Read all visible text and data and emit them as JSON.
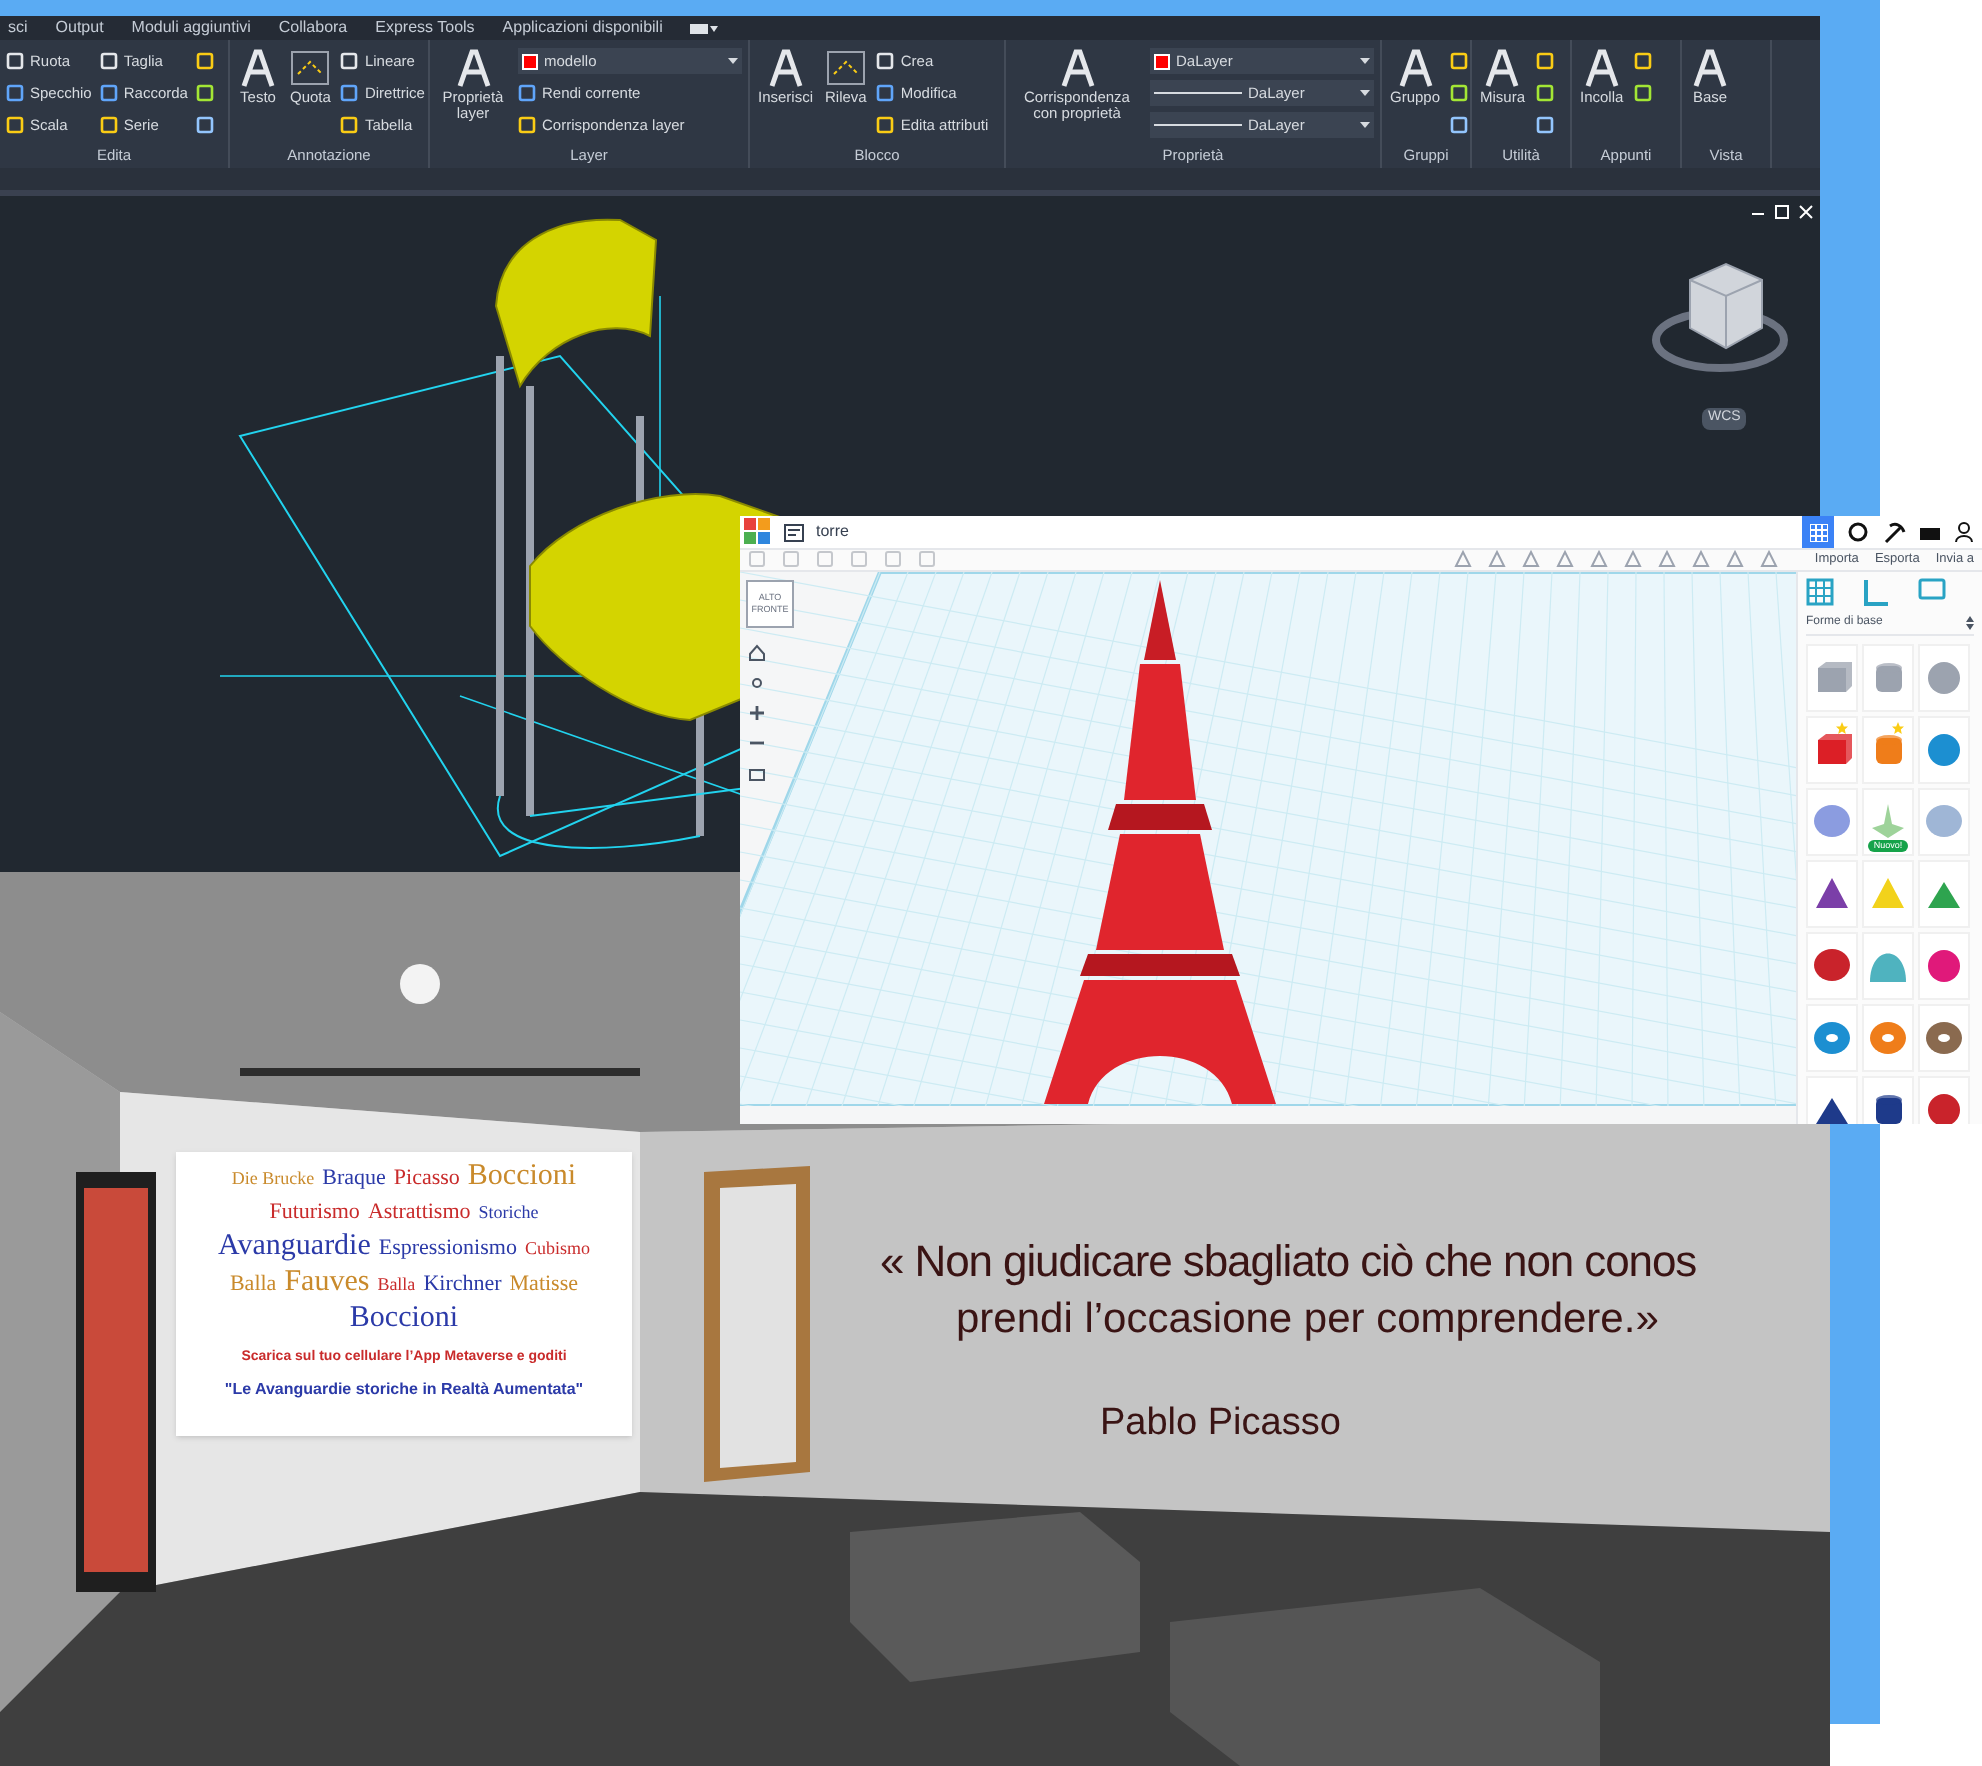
{
  "autocad": {
    "tabs": [
      "sci",
      "Output",
      "Moduli aggiuntivi",
      "Collabora",
      "Express Tools",
      "Applicazioni disponibili"
    ],
    "panels": [
      {
        "title": "Edita",
        "items": [
          {
            "kind": "small",
            "label": "Ruota"
          },
          {
            "kind": "small",
            "label": "Specchio"
          },
          {
            "kind": "small",
            "label": "Scala"
          },
          {
            "kind": "small",
            "label": "Taglia"
          },
          {
            "kind": "small",
            "label": "Raccorda"
          },
          {
            "kind": "small",
            "label": "Serie"
          },
          {
            "kind": "icon"
          },
          {
            "kind": "icon"
          },
          {
            "kind": "icon"
          }
        ]
      },
      {
        "title": "Annotazione",
        "items": [
          {
            "kind": "large",
            "label": "Testo"
          },
          {
            "kind": "large",
            "label": "Quota"
          },
          {
            "kind": "small",
            "label": "Lineare"
          },
          {
            "kind": "small",
            "label": "Direttrice"
          },
          {
            "kind": "small",
            "label": "Tabella"
          }
        ]
      },
      {
        "title": "Layer",
        "items": [
          {
            "kind": "large",
            "label": "Proprietà layer"
          },
          {
            "kind": "dropdown",
            "label": "modello",
            "color": "#ff0000"
          },
          {
            "kind": "small",
            "label": "Rendi corrente"
          },
          {
            "kind": "small",
            "label": "Corrispondenza layer"
          }
        ]
      },
      {
        "title": "Blocco",
        "items": [
          {
            "kind": "large",
            "label": "Inserisci"
          },
          {
            "kind": "large",
            "label": "Rileva"
          },
          {
            "kind": "small",
            "label": "Crea"
          },
          {
            "kind": "small",
            "label": "Modifica"
          },
          {
            "kind": "small",
            "label": "Edita attributi"
          }
        ]
      },
      {
        "title": "Proprietà",
        "items": [
          {
            "kind": "large",
            "label": "Corrispondenza con proprietà"
          },
          {
            "kind": "dropdown",
            "label": "DaLayer",
            "color": "#ff0000"
          },
          {
            "kind": "linetype",
            "label": "DaLayer"
          },
          {
            "kind": "linetype",
            "label": "DaLayer"
          }
        ]
      },
      {
        "title": "Gruppi",
        "items": [
          {
            "kind": "large",
            "label": "Gruppo"
          },
          {
            "kind": "icon"
          },
          {
            "kind": "icon"
          },
          {
            "kind": "icon"
          }
        ]
      },
      {
        "title": "Utilità",
        "items": [
          {
            "kind": "large",
            "label": "Misura"
          },
          {
            "kind": "icon"
          },
          {
            "kind": "icon"
          },
          {
            "kind": "icon"
          }
        ]
      },
      {
        "title": "Appunti",
        "items": [
          {
            "kind": "large",
            "label": "Incolla"
          },
          {
            "kind": "icon"
          },
          {
            "kind": "icon"
          }
        ]
      },
      {
        "title": "Vista",
        "items": [
          {
            "kind": "large",
            "label": "Base"
          }
        ]
      }
    ],
    "viewport": {
      "coordinate_label": "WCS"
    }
  },
  "tinkercad": {
    "title": "torre",
    "panel_tabs": [
      "Importa",
      "Esporta",
      "Invia a"
    ],
    "shape_category": "Forme di base",
    "shapes": [
      {
        "kind": "box",
        "color": "#9ca3af",
        "starred": false
      },
      {
        "kind": "cylinder",
        "color": "#9ca3af",
        "starred": false
      },
      {
        "kind": "sphere",
        "color": "#9ca3af",
        "starred": false
      },
      {
        "kind": "box",
        "color": "#dc1f26",
        "starred": true
      },
      {
        "kind": "cylinder",
        "color": "#ef7d1a",
        "starred": true
      },
      {
        "kind": "sphere",
        "color": "#1c8fd1",
        "starred": false
      },
      {
        "kind": "blob",
        "color": "#8b9ce0",
        "starred": false
      },
      {
        "kind": "spinner",
        "color": "#9ed39a",
        "starred": false,
        "badge": "Nuovo!"
      },
      {
        "kind": "blob",
        "color": "#9fb6d6",
        "starred": false
      },
      {
        "kind": "cone",
        "color": "#7b3fa8",
        "starred": false
      },
      {
        "kind": "cone",
        "color": "#f2d21b",
        "starred": false
      },
      {
        "kind": "wedge",
        "color": "#2ea44f",
        "starred": false
      },
      {
        "kind": "blob",
        "color": "#c9232b",
        "starred": false
      },
      {
        "kind": "halfcylinder",
        "color": "#4fb3bf",
        "starred": false
      },
      {
        "kind": "sphere",
        "color": "#e0197a",
        "starred": false
      },
      {
        "kind": "torus",
        "color": "#1c8fd1",
        "starred": false
      },
      {
        "kind": "torus",
        "color": "#ef7d1a",
        "starred": false
      },
      {
        "kind": "torus",
        "color": "#8a6a4f",
        "starred": false
      },
      {
        "kind": "wedge",
        "color": "#1e3a8a",
        "starred": false
      },
      {
        "kind": "cylinder",
        "color": "#1e3a8a",
        "starred": false
      },
      {
        "kind": "sphere",
        "color": "#c9232b",
        "starred": false
      }
    ],
    "view_cube": [
      "ALTO",
      "FRONTE"
    ]
  },
  "gallery": {
    "word_cloud": [
      {
        "text": "Die Brucke",
        "color": "#c98a2b"
      },
      {
        "text": "Braque",
        "color": "#2b3aa8"
      },
      {
        "text": "Picasso",
        "color": "#c92b2b"
      },
      {
        "text": "Boccioni",
        "color": "#c98a2b"
      },
      {
        "text": "Futurismo",
        "color": "#c92b2b"
      },
      {
        "text": "Astrattismo",
        "color": "#c92b2b"
      },
      {
        "text": "Storiche",
        "color": "#2b3aa8"
      },
      {
        "text": "Avanguardie",
        "color": "#2b3aa8"
      },
      {
        "text": "Espressionismo",
        "color": "#2b3aa8"
      },
      {
        "text": "Cubismo",
        "color": "#c92b2b"
      },
      {
        "text": "Balla",
        "color": "#c98a2b"
      },
      {
        "text": "Fauves",
        "color": "#c98a2b"
      },
      {
        "text": "Balla",
        "color": "#c92b2b"
      },
      {
        "text": "Kirchner",
        "color": "#2b3aa8"
      },
      {
        "text": "Matisse",
        "color": "#c98a2b"
      },
      {
        "text": "Boccioni",
        "color": "#2b3aa8"
      }
    ],
    "poster_line_1": "Scarica sul tuo cellulare l’App  Metaverse e goditi",
    "poster_line_2": "\"Le Avanguardie storiche in Realtà Aumentata\"",
    "quote_line_1": "« Non giudicare sbagliato ciò che non conos",
    "quote_line_2": "prendi l’occasione per comprendere.»",
    "quote_author": "Pablo Picasso"
  }
}
